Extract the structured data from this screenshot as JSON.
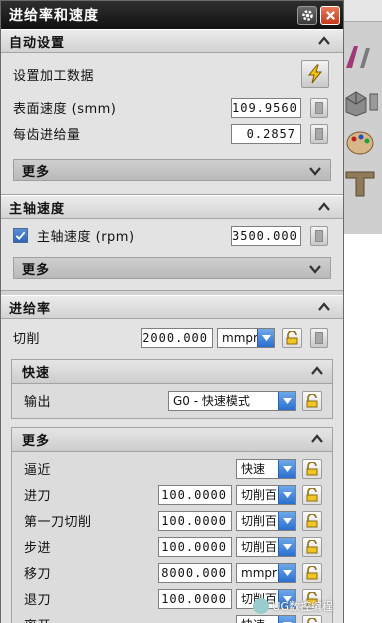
{
  "window": {
    "title": "进给率和速度"
  },
  "auto_settings": {
    "header": "自动设置",
    "set_machining_data_label": "设置加工数据",
    "surface_speed_label": "表面速度 (smm)",
    "surface_speed_value": "109.9560",
    "feed_per_tooth_label": "每齿进给量",
    "feed_per_tooth_value": "0.2857",
    "more_label": "更多"
  },
  "spindle": {
    "header": "主轴速度",
    "spindle_speed_label": "主轴速度 (rpm)",
    "spindle_speed_value": "3500.000",
    "spindle_checked": true,
    "more_label": "更多"
  },
  "feedrate": {
    "header": "进给率",
    "cut_label": "切削",
    "cut_value": "2000.000",
    "cut_unit": "mmpr",
    "rapid": {
      "header": "快速",
      "output_label": "输出",
      "output_value": "G0 - 快速模式"
    },
    "more": {
      "header": "更多",
      "rows": [
        {
          "label": "逼近",
          "value": "",
          "unit": "快速"
        },
        {
          "label": "进刀",
          "value": "100.0000",
          "unit": "切削百"
        },
        {
          "label": "第一刀切削",
          "value": "100.0000",
          "unit": "切削百"
        },
        {
          "label": "步进",
          "value": "100.0000",
          "unit": "切削百"
        },
        {
          "label": "移刀",
          "value": "8000.000",
          "unit": "mmpr"
        },
        {
          "label": "退刀",
          "value": "100.0000",
          "unit": "切削百"
        },
        {
          "label": "离开",
          "value": "",
          "unit": "快速"
        }
      ]
    }
  },
  "watermark": "UG数控编程",
  "colors": {
    "titlebar": "#1a1a1a",
    "dropdown_accent": "#2a6fcf",
    "close_button": "#c53a1e"
  }
}
